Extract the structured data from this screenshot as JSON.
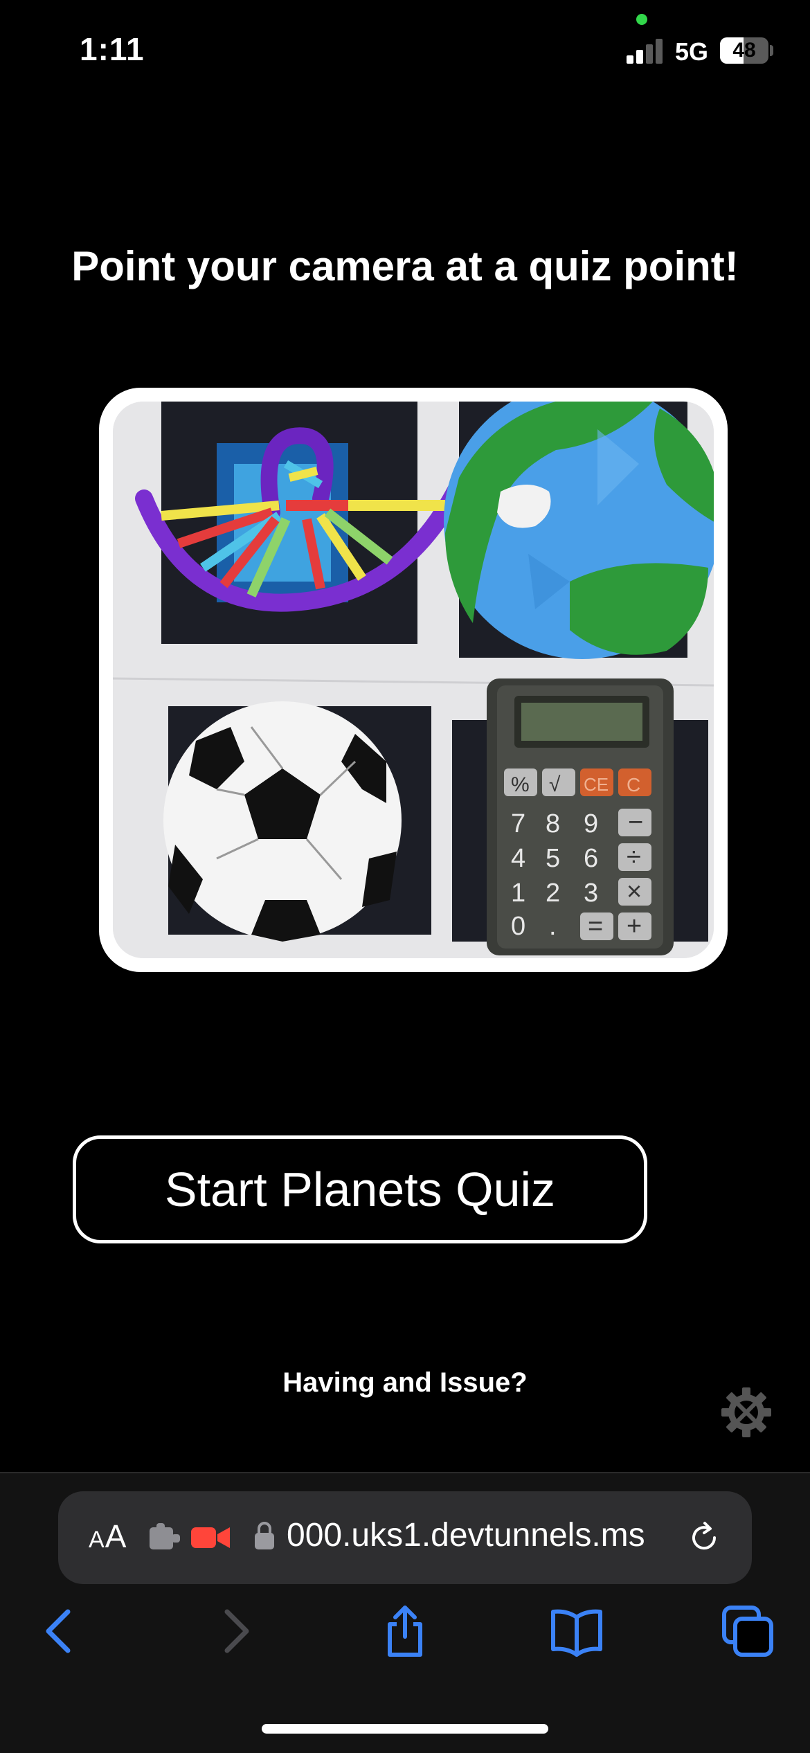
{
  "status_bar": {
    "time": "1:11",
    "network": "5G",
    "battery_level": "48",
    "battery_fraction": 0.48,
    "signal_bars_active": 2,
    "signal_bars_total": 4,
    "privacy_dot_color": "#32d74b"
  },
  "page": {
    "heading": "Point your camera at a quiz point!",
    "start_button_label": "Start Planets Quiz",
    "issue_link": "Having and Issue?"
  },
  "browser": {
    "text_size_small": "A",
    "text_size_large": "A",
    "url": "000.uks1.devtunnels.ms",
    "accent_color": "#3b82f6",
    "camera_indicator_color": "#ff453a"
  }
}
